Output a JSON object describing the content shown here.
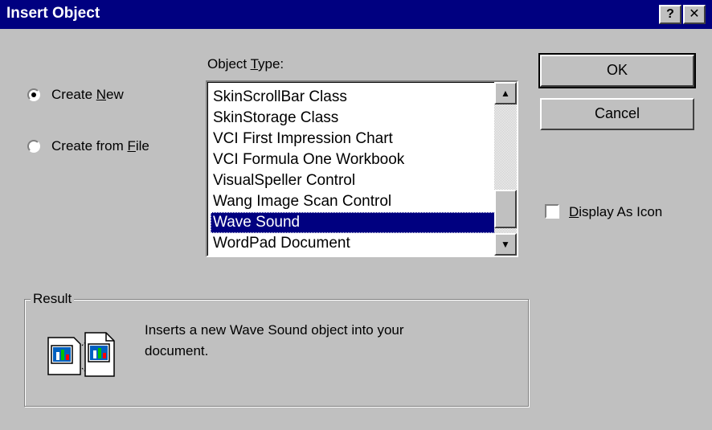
{
  "window": {
    "title": "Insert Object",
    "help_button": "?",
    "close_button": "✕"
  },
  "options": {
    "create_new_label_pre": "Create ",
    "create_new_label_key": "N",
    "create_new_label_post": "ew",
    "create_from_file_label_pre": "Create from ",
    "create_from_file_label_key": "F",
    "create_from_file_label_post": "ile",
    "selected": "create_new"
  },
  "object_type": {
    "label_pre": "Object ",
    "label_key": "T",
    "label_post": "ype:",
    "items": [
      "SkinScrollBar Class",
      "SkinStorage Class",
      "VCI First Impression Chart",
      "VCI Formula One Workbook",
      "VisualSpeller Control",
      "Wang Image Scan Control",
      "Wave Sound",
      "WordPad Document"
    ],
    "selected_index": 6
  },
  "buttons": {
    "ok": "OK",
    "cancel": "Cancel"
  },
  "display_as_icon": {
    "label_key": "D",
    "label_post": "isplay As Icon",
    "checked": false
  },
  "result": {
    "title": "Result",
    "line1": "Inserts a new Wave Sound object into your",
    "line2": "document."
  },
  "icons": {
    "scroll_up": "scroll-up-arrow-icon",
    "scroll_down": "scroll-down-arrow-icon",
    "result_icon": "insert-new-object-icon"
  },
  "colors": {
    "title_bar": "#000080",
    "face": "#c0c0c0",
    "selection": "#000080"
  }
}
